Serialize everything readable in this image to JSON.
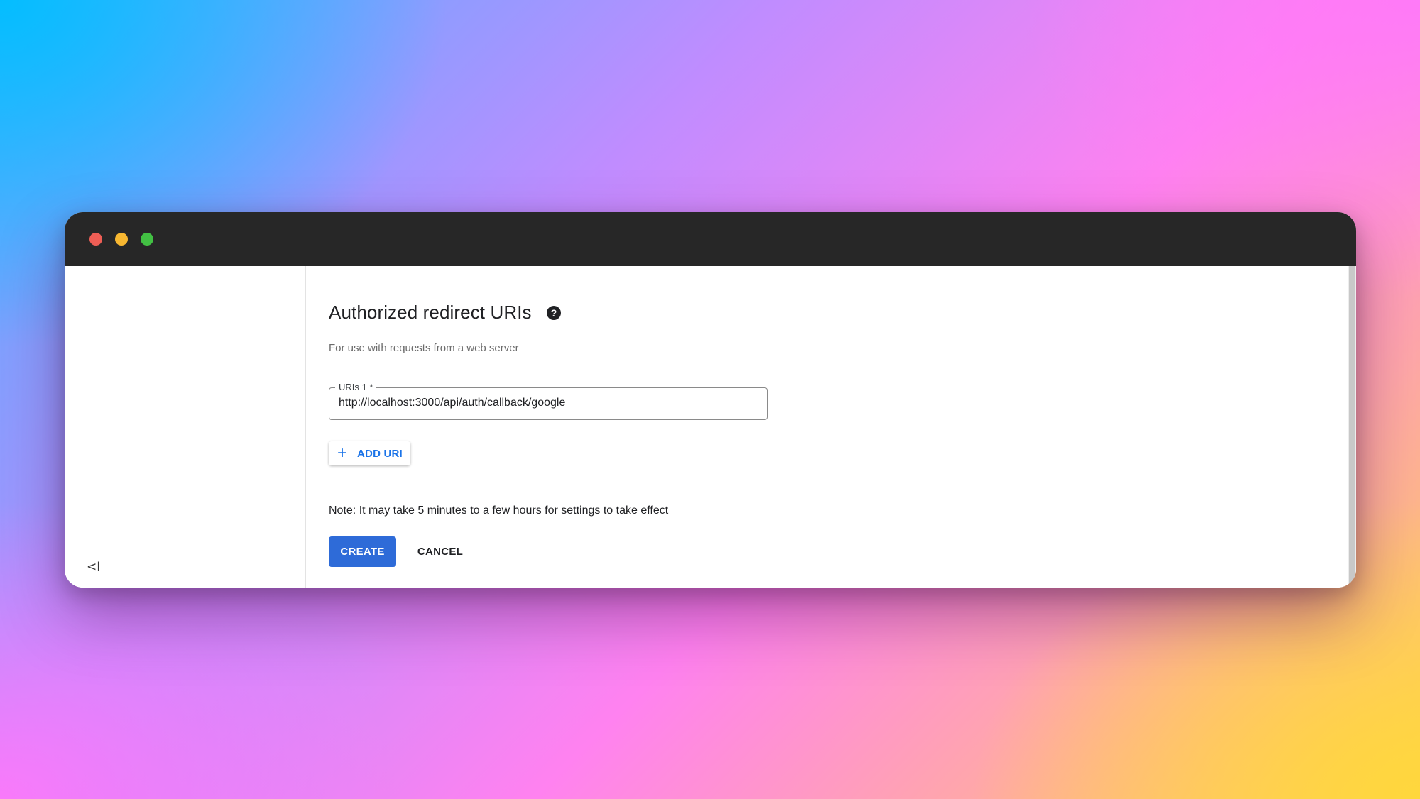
{
  "window": {
    "controls": {
      "close_color": "#ee5e55",
      "minimize_color": "#f7b731",
      "maximize_color": "#42c043"
    }
  },
  "sidebar": {
    "collapse_icon": "collapse-sidebar-icon",
    "collapse_glyph": "<I"
  },
  "form": {
    "title": "Authorized redirect URIs",
    "help_icon": "help-icon",
    "help_glyph": "?",
    "subtitle": "For use with requests from a web server",
    "uri_field": {
      "label": "URIs 1 *",
      "value": "http://localhost:3000/api/auth/callback/google"
    },
    "add_uri": {
      "icon": "plus-icon",
      "glyph": "+",
      "label": "ADD URI"
    },
    "note": "Note: It may take 5 minutes to a few hours for settings to take effect",
    "create_label": "CREATE",
    "cancel_label": "CANCEL"
  },
  "colors": {
    "primary": "#2e6bd8",
    "link": "#1a73e8",
    "titlebar": "#272727"
  }
}
